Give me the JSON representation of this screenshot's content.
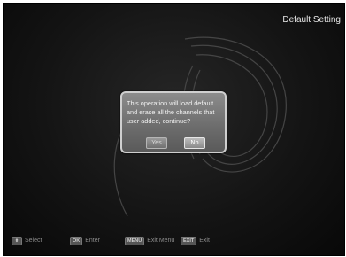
{
  "screen": {
    "title": "Default Setting"
  },
  "dialog": {
    "message": "This operation will load default and erase all the channels that user added, continue?",
    "yes_label": "Yes",
    "no_label": "No",
    "selected": "No"
  },
  "footer": {
    "select_key": "⬍",
    "select_label": "Select",
    "ok_key": "OK",
    "ok_label": "Enter",
    "menu_key": "MENU",
    "menu_label": "Exit Menu",
    "exit_key": "EXIT",
    "exit_label": "Exit"
  },
  "colors": {
    "background": "#141414",
    "dialog": "#7a7a7a",
    "text": "#f2f2f2",
    "footer_text": "#8c8c8c"
  }
}
